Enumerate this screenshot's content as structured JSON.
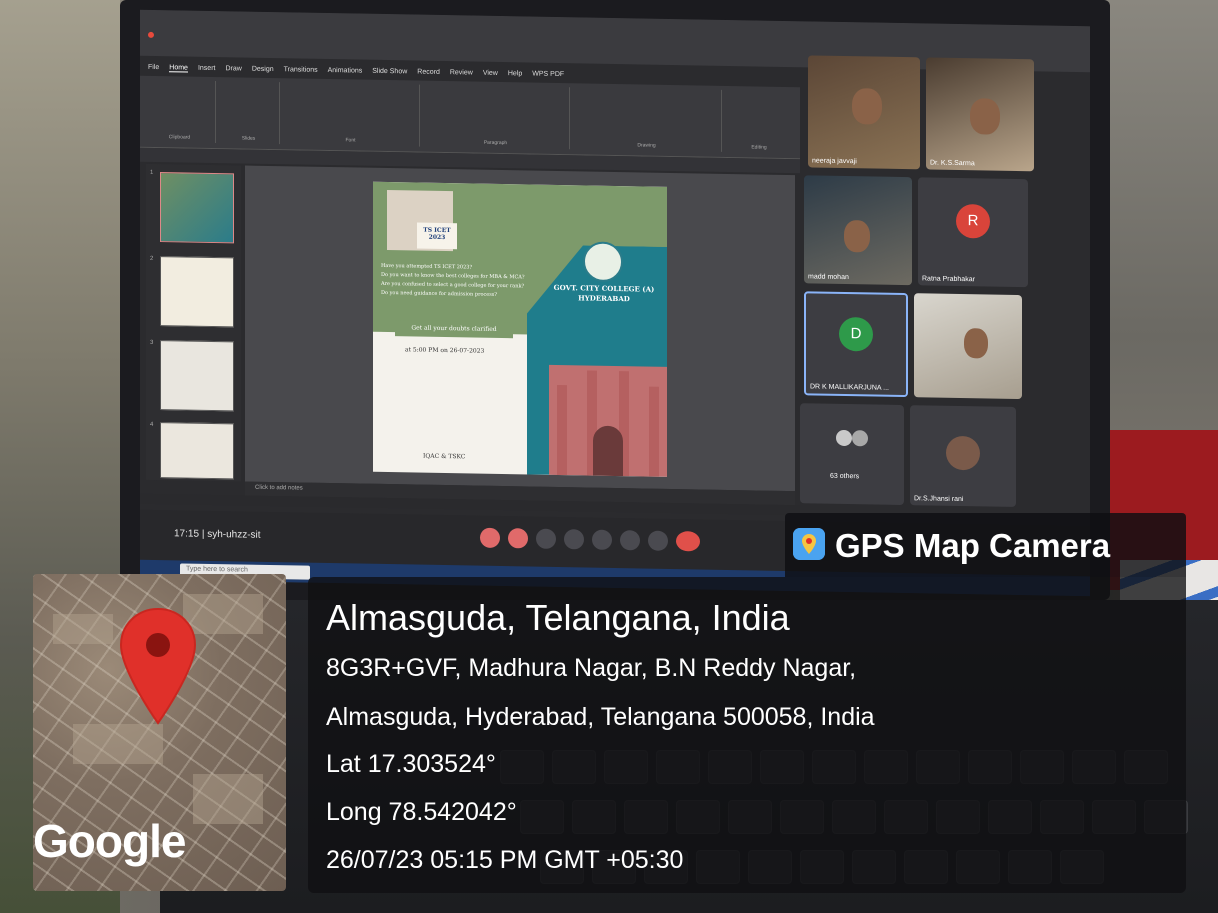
{
  "gps": {
    "app_name": "GPS Map Camera",
    "place": "Almasguda, Telangana, India",
    "address_line1": "8G3R+GVF, Madhura Nagar, B.N Reddy Nagar,",
    "address_line2": "Almasguda, Hyderabad, Telangana 500058, India",
    "latitude": "Lat 17.303524°",
    "longitude": "Long 78.542042°",
    "datetime": "26/07/23 05:15 PM GMT +05:30",
    "map_brand": "Google",
    "pin_color": "#e0302a"
  },
  "meeting": {
    "time": "17:15",
    "code": "syh-uhzz-sit",
    "participants": [
      {
        "name": "neeraja javvaji"
      },
      {
        "name": "Dr. K.S.Sarma"
      },
      {
        "name": "madd mohan"
      },
      {
        "name": "Ratna Prabhakar",
        "initial": "R",
        "color": "#d9443a"
      },
      {
        "name": "DR K MALLIKARJUNA ...",
        "initial": "D",
        "color": "#2e9a4a"
      },
      {
        "name": ""
      },
      {
        "name": "63 others"
      },
      {
        "name": "Dr.S.Jhansi rani"
      }
    ]
  },
  "ppt": {
    "menu": [
      "File",
      "Home",
      "Insert",
      "Draw",
      "Design",
      "Transitions",
      "Animations",
      "Slide Show",
      "Record",
      "Review",
      "View",
      "Help",
      "WPS PDF"
    ],
    "ribbon_groups": [
      "Clipboard",
      "Slides",
      "Font",
      "Paragraph",
      "Drawing",
      "Editing"
    ],
    "notes_placeholder": "Click to add notes",
    "slide": {
      "title_box": "TS ICET 2023",
      "bullets": [
        "Have you attempted TS ICET 2023?",
        "Do you want to know the best colleges for MBA & MCA?",
        "Are you confused to select a good college for your rank?",
        "Do you need guidance for admission process?"
      ],
      "banner": "Get all your doubts clarified",
      "time": "at 5:00 PM on 26-07-2023",
      "college": "GOVT. CITY COLLEGE (A)",
      "city": "HYDERABAD",
      "organizer": "IQAC & TSKC"
    }
  },
  "taskbar": {
    "search_placeholder": "Type here to search"
  }
}
